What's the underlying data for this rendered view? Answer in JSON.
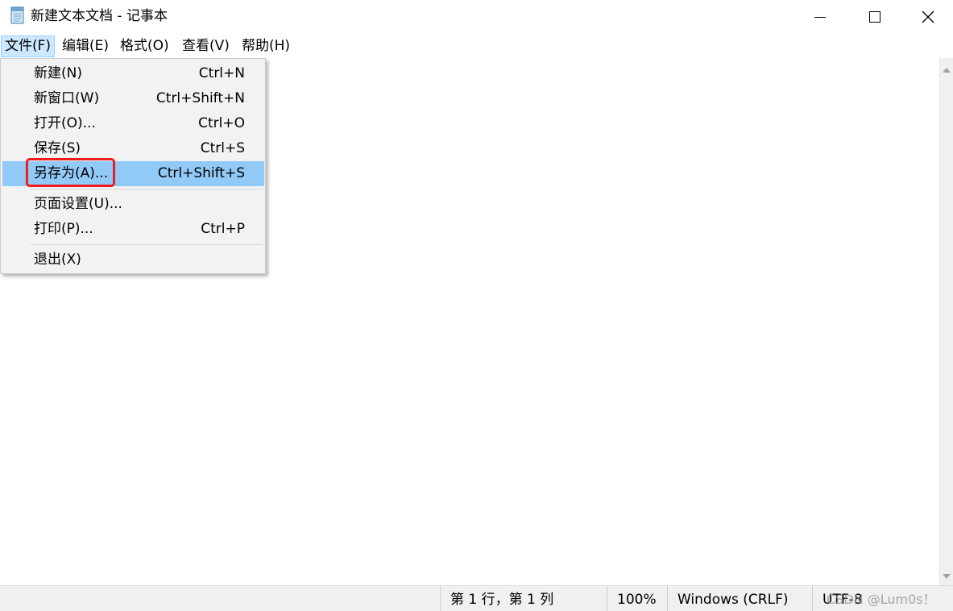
{
  "window": {
    "title": "新建文本文档 - 记事本",
    "app_icon": "notepad-icon",
    "controls": {
      "minimize_icon": "minimize-icon",
      "maximize_icon": "maximize-icon",
      "close_icon": "close-icon"
    }
  },
  "menubar": {
    "items": [
      {
        "label": "文件(F)",
        "active": true
      },
      {
        "label": "编辑(E)"
      },
      {
        "label": "格式(O)"
      },
      {
        "label": "查看(V)"
      },
      {
        "label": "帮助(H)"
      }
    ]
  },
  "file_menu": {
    "items": [
      {
        "label": "新建(N)",
        "shortcut": "Ctrl+N"
      },
      {
        "label": "新窗口(W)",
        "shortcut": "Ctrl+Shift+N"
      },
      {
        "label": "打开(O)...",
        "shortcut": "Ctrl+O"
      },
      {
        "label": "保存(S)",
        "shortcut": "Ctrl+S"
      },
      {
        "label": "另存为(A)...",
        "shortcut": "Ctrl+Shift+S",
        "highlighted": true
      },
      {
        "label": "页面设置(U)...",
        "shortcut": ""
      },
      {
        "label": "打印(P)...",
        "shortcut": "Ctrl+P"
      },
      {
        "label": "退出(X)",
        "shortcut": ""
      }
    ],
    "highlight_color": "#91c9f7",
    "annotation_color": "#ee1c1c"
  },
  "statusbar": {
    "position": "第 1 行，第 1 列",
    "zoom": "100%",
    "line_ending": "Windows (CRLF)",
    "encoding": "UTF-8"
  },
  "watermark": "CSDN @Lum0s！"
}
